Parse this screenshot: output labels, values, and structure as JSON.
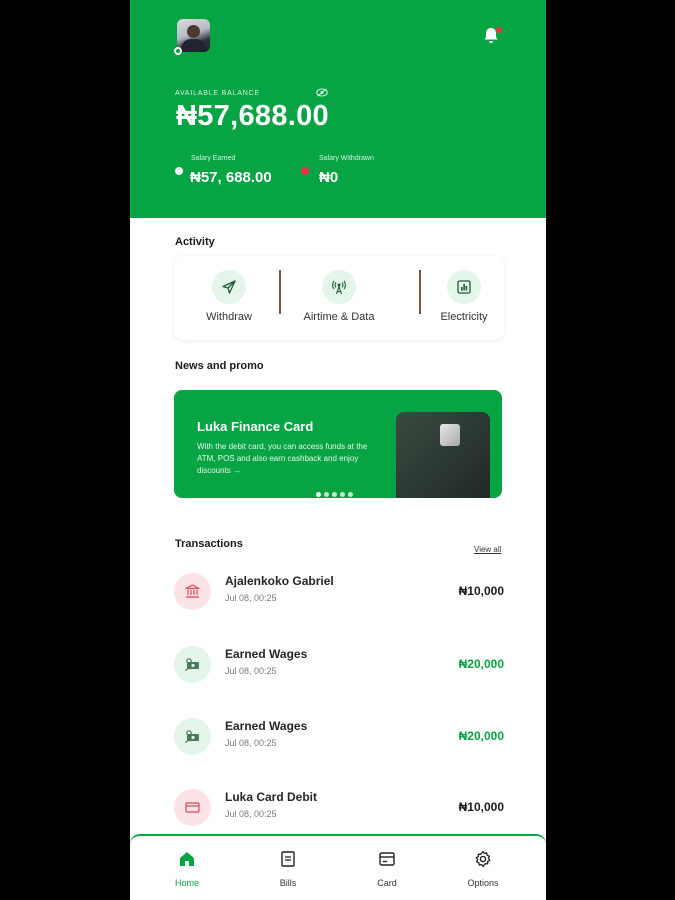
{
  "header": {
    "balance_label": "AVAILABLE BALANCE",
    "balance": "₦57,688.00",
    "salary_earned_label": "Salary Earned",
    "salary_earned": "₦57, 688.00",
    "salary_withdrawn_label": "Salary Withdrawn",
    "salary_withdrawn": "₦0"
  },
  "activity": {
    "title": "Activity",
    "items": [
      {
        "label": "Withdraw",
        "icon": "send-icon"
      },
      {
        "label": "Airtime & Data",
        "icon": "signal-tower-icon"
      },
      {
        "label": "Electricity",
        "icon": "meter-icon"
      }
    ]
  },
  "news": {
    "title": "News and promo",
    "promo_title": "Luka Finance Card",
    "promo_text": "With the debit card, you can access funds at the ATM, POS and also earn cashback and enjoy discounts →",
    "slides": 5,
    "active_slide": 1
  },
  "transactions": {
    "title": "Transactions",
    "view_all": "View all",
    "items": [
      {
        "name": "Ajalenkoko Gabriel",
        "date": "Jul 08, 00:25",
        "amount": "₦10,000",
        "type": "debit",
        "icon": "bank-icon"
      },
      {
        "name": "Earned Wages",
        "date": "Jul 08, 00:25",
        "amount": "₦20,000",
        "type": "credit",
        "icon": "money-icon"
      },
      {
        "name": "Earned Wages",
        "date": "Jul 08, 00:25",
        "amount": "₦20,000",
        "type": "credit",
        "icon": "money-icon"
      },
      {
        "name": "Luka Card Debit",
        "date": "Jul 08, 00:25",
        "amount": "₦10,000",
        "type": "debit",
        "icon": "card-icon"
      }
    ]
  },
  "nav": {
    "items": [
      {
        "label": "Home",
        "icon": "home-icon",
        "active": true
      },
      {
        "label": "Bills",
        "icon": "bills-icon",
        "active": false
      },
      {
        "label": "Card",
        "icon": "card-icon",
        "active": false
      },
      {
        "label": "Options",
        "icon": "gear-icon",
        "active": false
      }
    ]
  },
  "colors": {
    "brand": "#06a442",
    "alert": "#e8334a"
  }
}
